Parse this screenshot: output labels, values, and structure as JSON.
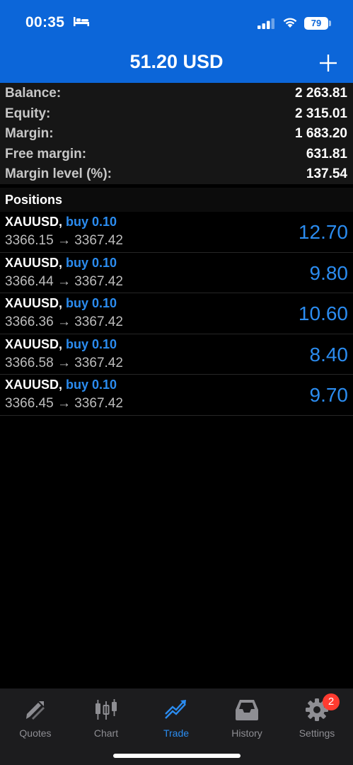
{
  "status_bar": {
    "time": "00:35",
    "battery": "79"
  },
  "header": {
    "title": "51.20 USD"
  },
  "summary": [
    {
      "label": "Balance:",
      "value": "2 263.81"
    },
    {
      "label": "Equity:",
      "value": "2 315.01"
    },
    {
      "label": "Margin:",
      "value": "1 683.20"
    },
    {
      "label": "Free margin:",
      "value": "631.81"
    },
    {
      "label": "Margin level (%):",
      "value": "137.54"
    }
  ],
  "positions_header": "Positions",
  "positions": [
    {
      "symbol": "XAUUSD,",
      "side": "buy 0.10",
      "prices": "3366.15 → 3367.42",
      "profit": "12.70"
    },
    {
      "symbol": "XAUUSD,",
      "side": "buy 0.10",
      "prices": "3366.44 → 3367.42",
      "profit": "9.80"
    },
    {
      "symbol": "XAUUSD,",
      "side": "buy 0.10",
      "prices": "3366.36 → 3367.42",
      "profit": "10.60"
    },
    {
      "symbol": "XAUUSD,",
      "side": "buy 0.10",
      "prices": "3366.58 → 3367.42",
      "profit": "8.40"
    },
    {
      "symbol": "XAUUSD,",
      "side": "buy 0.10",
      "prices": "3366.45 → 3367.42",
      "profit": "9.70"
    }
  ],
  "tabs": [
    {
      "label": "Quotes",
      "icon": "quotes-icon"
    },
    {
      "label": "Chart",
      "icon": "chart-icon"
    },
    {
      "label": "Trade",
      "icon": "trade-icon",
      "active": true
    },
    {
      "label": "History",
      "icon": "history-icon"
    },
    {
      "label": "Settings",
      "icon": "gear-icon",
      "badge": "2"
    }
  ],
  "colors": {
    "header_blue": "#0c66d9",
    "accent_blue": "#2b8cf0",
    "badge_red": "#ff3b30"
  }
}
